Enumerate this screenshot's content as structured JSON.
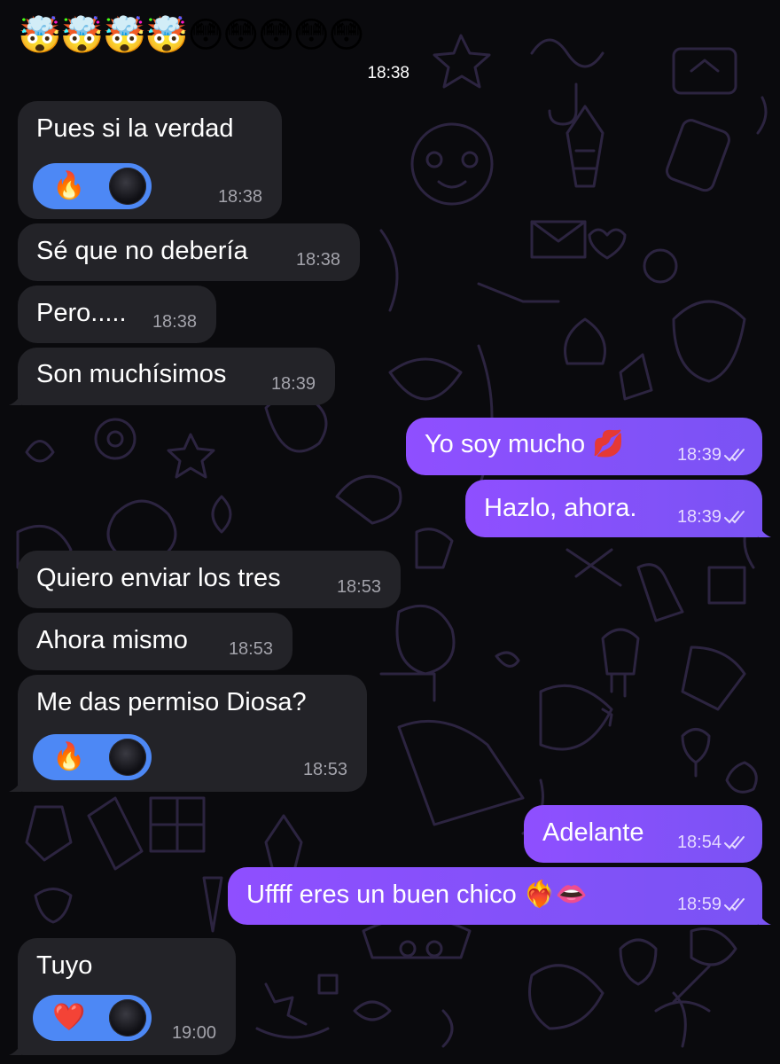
{
  "top": {
    "emojis": "🤯🤯🤯🤯😳😳😳😳😳",
    "time": "18:38"
  },
  "messages": [
    {
      "id": "m1",
      "dir": "in",
      "text": "Pues si la verdad",
      "time": "18:38",
      "reaction": {
        "emoji": "🔥"
      }
    },
    {
      "id": "m2",
      "dir": "in",
      "text": "Sé que no debería",
      "time": "18:38"
    },
    {
      "id": "m3",
      "dir": "in",
      "text": "Pero.....",
      "time": "18:38"
    },
    {
      "id": "m4",
      "dir": "in",
      "text": "Son muchísimos",
      "time": "18:39"
    },
    {
      "id": "m5",
      "dir": "out",
      "text": "Yo soy mucho 💋",
      "time": "18:39"
    },
    {
      "id": "m6",
      "dir": "out",
      "text": "Hazlo, ahora.",
      "time": "18:39"
    },
    {
      "id": "m7",
      "dir": "in",
      "text": "Quiero enviar los tres",
      "time": "18:53"
    },
    {
      "id": "m8",
      "dir": "in",
      "text": "Ahora mismo",
      "time": "18:53"
    },
    {
      "id": "m9",
      "dir": "in",
      "text": "Me das permiso Diosa?",
      "time": "18:53",
      "reaction": {
        "emoji": "🔥"
      }
    },
    {
      "id": "m10",
      "dir": "out",
      "text": "Adelante",
      "time": "18:54"
    },
    {
      "id": "m11",
      "dir": "out",
      "text": "Uffff eres un buen chico ❤️‍🔥👄",
      "time": "18:59"
    },
    {
      "id": "m12",
      "dir": "in",
      "text": "Tuyo",
      "time": "19:00",
      "reaction": {
        "emoji": "❤️"
      }
    }
  ],
  "colors": {
    "background": "#0a0a0d",
    "incoming_bubble": "#232328",
    "outgoing_bubble": "#8a50fb",
    "reaction_pill": "#4d88f5",
    "wallpaper_doodles": "#2c2440"
  }
}
